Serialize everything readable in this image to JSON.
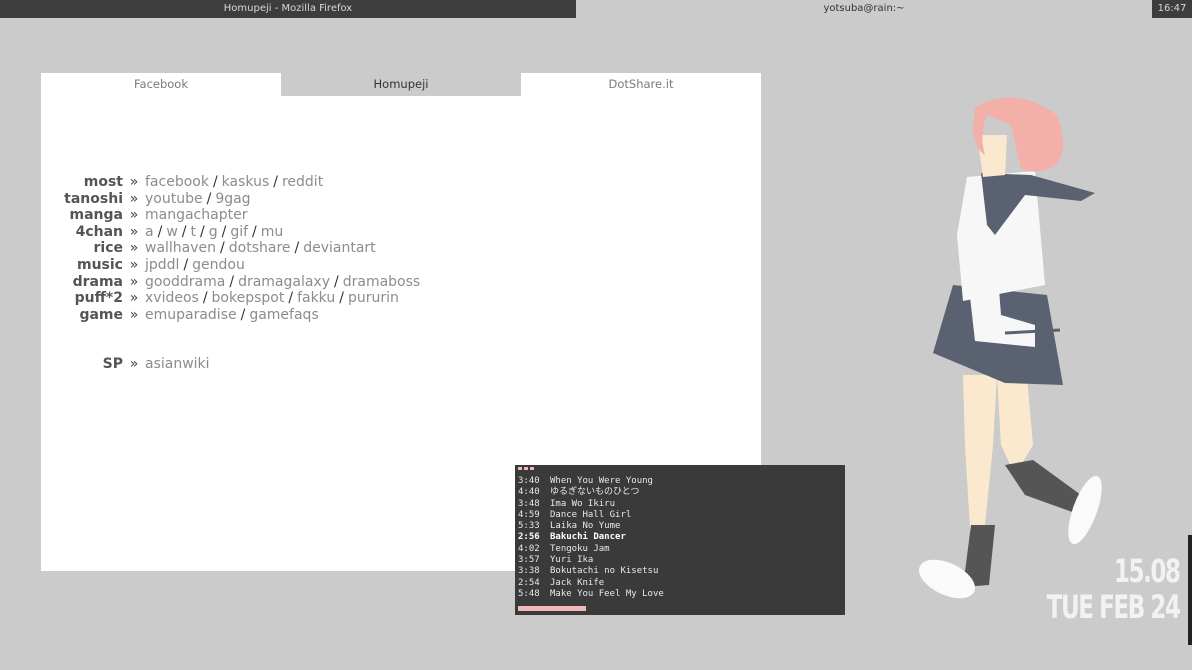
{
  "topbar": {
    "window_title": "Homupeji - Mozilla Firefox",
    "terminal_title": "yotsuba@rain:~",
    "clock": "16:47"
  },
  "browser": {
    "tabs": [
      {
        "label": "Facebook",
        "active": false
      },
      {
        "label": "Homupeji",
        "active": true
      },
      {
        "label": "DotShare.it",
        "active": false
      }
    ],
    "arrow": "»",
    "separator": "/",
    "categories": [
      {
        "label": "most",
        "links": [
          "facebook",
          "kaskus",
          "reddit"
        ]
      },
      {
        "label": "tanoshi",
        "links": [
          "youtube",
          "9gag"
        ]
      },
      {
        "label": "manga",
        "links": [
          "mangachapter"
        ]
      },
      {
        "label": "4chan",
        "links": [
          "a",
          "w",
          "t",
          "g",
          "gif",
          "mu"
        ]
      },
      {
        "label": "rice",
        "links": [
          "wallhaven",
          "dotshare",
          "deviantart"
        ]
      },
      {
        "label": "music",
        "links": [
          "jpddl",
          "gendou"
        ]
      },
      {
        "label": "drama",
        "links": [
          "gooddrama",
          "dramagalaxy",
          "dramaboss"
        ]
      },
      {
        "label": "puff*2",
        "links": [
          "xvideos",
          "bokepspot",
          "fakku",
          "pururin"
        ]
      },
      {
        "label": "game",
        "links": [
          "emuparadise",
          "gamefaqs"
        ]
      },
      {
        "label": "SP",
        "links": [
          "asianwiki"
        ]
      }
    ]
  },
  "player": {
    "tracks": [
      {
        "duration": "3:40",
        "title": "When You Were Young",
        "current": false
      },
      {
        "duration": "4:40",
        "title": "ゆるぎないものひとつ",
        "current": false
      },
      {
        "duration": "3:48",
        "title": "Ima Wo Ikiru",
        "current": false
      },
      {
        "duration": "4:59",
        "title": "Dance Hall Girl",
        "current": false
      },
      {
        "duration": "5:33",
        "title": "Laika No Yume",
        "current": false
      },
      {
        "duration": "2:56",
        "title": "Bakuchi Dancer",
        "current": true
      },
      {
        "duration": "4:02",
        "title": "Tengoku Jam",
        "current": false
      },
      {
        "duration": "3:57",
        "title": "Yuri Ika",
        "current": false
      },
      {
        "duration": "3:38",
        "title": "Bokutachi no Kisetsu",
        "current": false
      },
      {
        "duration": "2:54",
        "title": "Jack Knife",
        "current": false
      },
      {
        "duration": "5:48",
        "title": "Make You Feel My Love",
        "current": false
      }
    ]
  },
  "desktop": {
    "time": "15.08",
    "date": "TUE FEB 24"
  },
  "colors": {
    "bar": "#3d3d3d",
    "desktop": "#cbcbcb",
    "accent_pink": "#f3b9b9",
    "hair": "#f2b0a8",
    "skirt": "#5a6170"
  }
}
